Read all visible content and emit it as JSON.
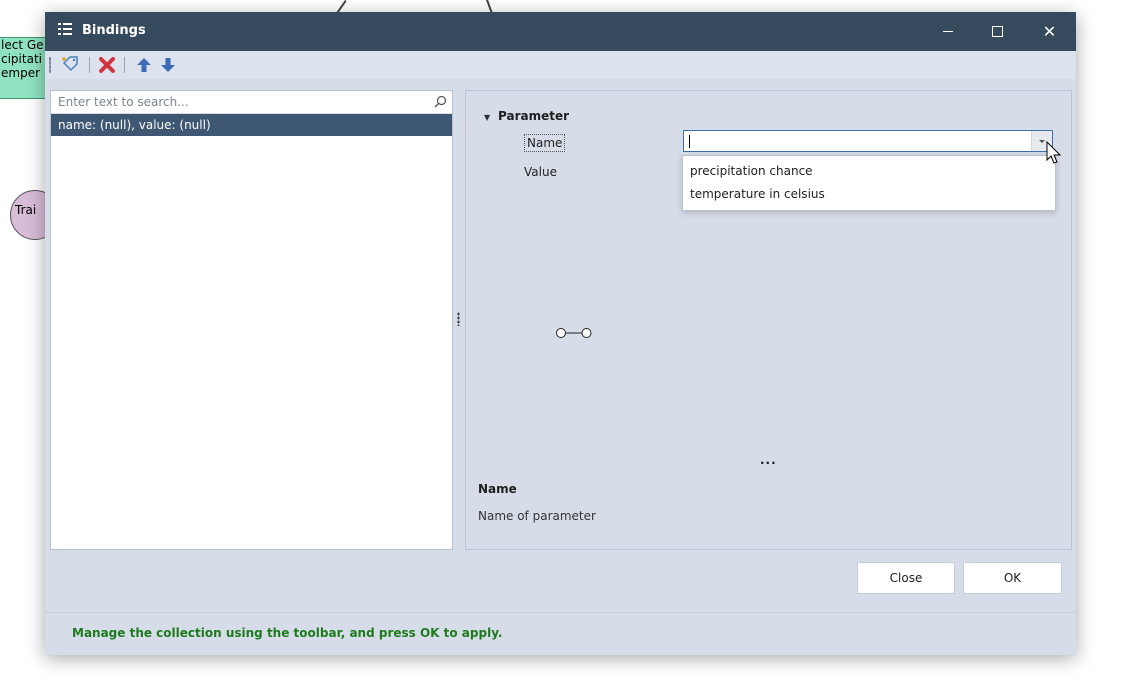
{
  "background": {
    "green_node_lines": [
      "lect Ge",
      "cipitati",
      "emper"
    ],
    "circle_node_text": "Trai"
  },
  "dialog": {
    "title": "Bindings",
    "title_icon": "list-icon",
    "window_controls": [
      "minimize",
      "maximize",
      "close"
    ]
  },
  "toolbar": {
    "items": [
      {
        "name": "add-tag-icon",
        "color": "#4a7fc1"
      },
      {
        "name": "delete-icon",
        "color": "#d0343f"
      },
      {
        "name": "move-up-icon",
        "color": "#3a6db5"
      },
      {
        "name": "move-down-icon",
        "color": "#3a6db5"
      }
    ]
  },
  "search": {
    "placeholder": "Enter text to search..."
  },
  "list": {
    "items": [
      "name: (null), value: (null)"
    ],
    "selected_index": 0
  },
  "properties": {
    "section": "Parameter",
    "name_label": "Name",
    "value_label": "Value",
    "name_value": "",
    "options": [
      "precipitation chance",
      "temperature in celsius"
    ]
  },
  "help": {
    "ellipsis": "...",
    "title": "Name",
    "description": "Name of parameter"
  },
  "buttons": {
    "close": "Close",
    "ok": "OK"
  },
  "status": {
    "text": "Manage the collection using the toolbar, and press OK to apply.",
    "color": "#1d7a1d"
  },
  "colors": {
    "titlebar": "#364a5e",
    "selection": "#3e5772",
    "panel": "#d6dde9"
  }
}
